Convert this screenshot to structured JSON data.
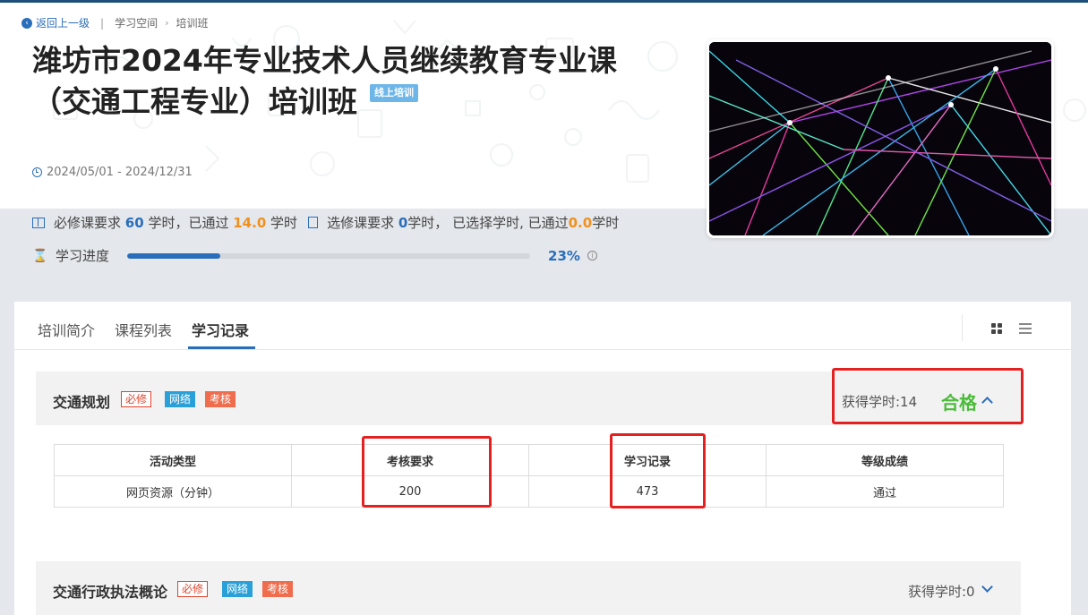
{
  "breadcrumb": {
    "back_label": "返回上一级",
    "separator": "|",
    "items": [
      "学习空间",
      "培训班"
    ]
  },
  "header": {
    "title_line1": "潍坊市2024年专业技术人员继续教育专业课",
    "title_line2": "（交通工程专业）培训班",
    "online_tag": "线上培训",
    "date_range": "2024/05/01 - 2024/12/31"
  },
  "requirements": {
    "required_prefix": "必修课要求",
    "required_hours": "60",
    "required_mid": "学时，已通过",
    "required_passed": "14.0",
    "required_suffix": "学时",
    "elective_prefix": "选修课要求",
    "elective_hours": "0",
    "elective_mid": "学时，  已选择学时, 已通过",
    "elective_passed": "0.0",
    "elective_suffix": "学时"
  },
  "progress": {
    "label": "学习进度",
    "percent_text": "23%",
    "fraction": 0.23
  },
  "tabs": [
    {
      "label": "培训简介",
      "active": false
    },
    {
      "label": "课程列表",
      "active": false
    },
    {
      "label": "学习记录",
      "active": true
    }
  ],
  "courses": [
    {
      "name": "交通规划",
      "tags": [
        "必修",
        "网络",
        "考核"
      ],
      "hours_text": "获得学时:14",
      "status": "合格",
      "expanded": true
    },
    {
      "name": "交通行政执法概论",
      "tags": [
        "必修",
        "网络",
        "考核"
      ],
      "hours_text": "获得学时:0",
      "status": "",
      "expanded": false
    }
  ],
  "record_table": {
    "headers": [
      "活动类型",
      "考核要求",
      "学习记录",
      "等级成绩"
    ],
    "rows": [
      [
        "网页资源（分钟）",
        "200",
        "473",
        "通过"
      ]
    ]
  },
  "colors": {
    "accent": "#2a6ebb",
    "highlight": "#f0901e",
    "pass_green": "#4cbb3a",
    "annotation_red": "#e42121"
  },
  "icons": [
    "back-arrow-icon",
    "clock-icon",
    "book-icon",
    "document-icon",
    "hourglass-icon",
    "info-icon",
    "grid-view-icon",
    "list-view-icon",
    "chevron-up-icon",
    "chevron-down-icon"
  ]
}
